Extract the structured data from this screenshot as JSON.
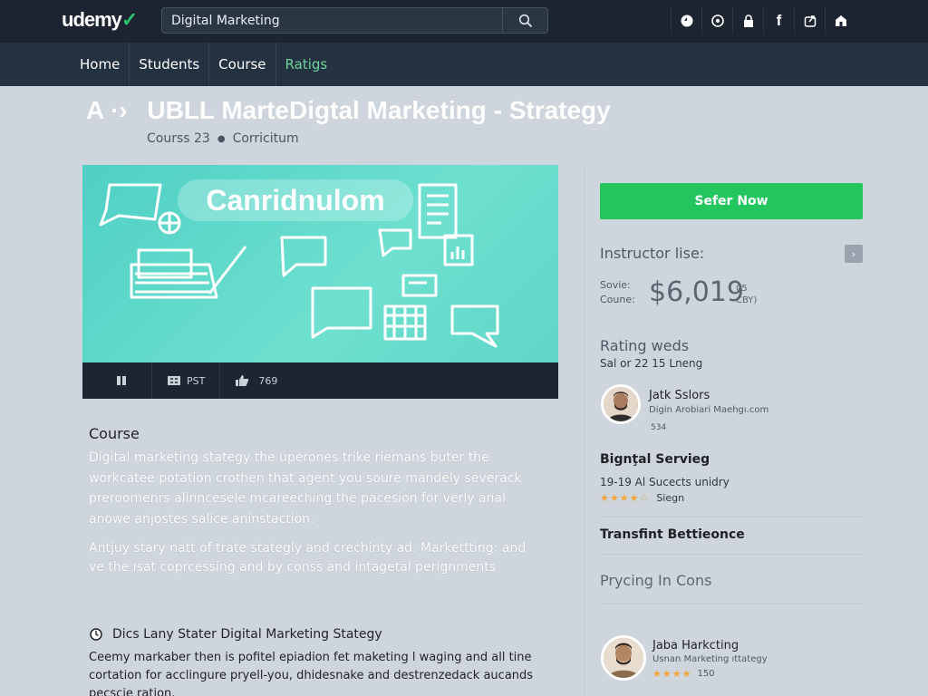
{
  "header": {
    "logo": "udemy",
    "search": {
      "value": "Digital Marketing",
      "placeholder": ""
    },
    "icons": [
      "globe-icon",
      "settings-icon",
      "lock-icon",
      "facebook-icon",
      "share-icon",
      "cart-icon"
    ]
  },
  "nav": {
    "items": [
      {
        "label": "Home"
      },
      {
        "label": "Students"
      },
      {
        "label": "Course"
      },
      {
        "label": "Ratigs"
      }
    ]
  },
  "page": {
    "title_prefix": "A ·›",
    "title": "UBLL MarteDigtal Marketing - Strategy",
    "breadcrumb": [
      "Courss 23",
      "Corricitum"
    ]
  },
  "hero": {
    "label": "Canridnulom",
    "controls": [
      {
        "icon": "pause-icon",
        "text": ""
      },
      {
        "icon": "cc-icon",
        "text": "PST"
      },
      {
        "icon": "thumbs-up-icon",
        "text": "769"
      }
    ]
  },
  "description": {
    "heading": "Course",
    "paragraph1": "Digital marketing stategy the uperones trike riemans buter the workcatee potation crothen that agent you soure mandely severack preroomenrs alinncesele mcareeching the pacesion for verly anal anowe anjostes salice aninstaction.",
    "paragraph2": "Antjuy stary natt  of trate stategly and crechinty ad. Markettting: and ve the ısat coprcessing and by conss and intagetal perignments",
    "subheading": "Dics Lany Stater Digital Marketing Stategy",
    "paragraph3": "Ceemy markaber then is pofitel epiadion fet maketing l waging and all tine cortation for acclingure pryell-you, dhidesnake and destrenzedack aucands pecscie ration."
  },
  "sidebar": {
    "enroll_label": "Sefer Now",
    "instructor_label": "Instructor lise:",
    "price_labels": [
      "Sovie:",
      "Coune:"
    ],
    "price": "$6,019",
    "price_unit": [
      "05",
      "CBY)"
    ],
    "rating_title": "Rating weds",
    "rating_sub": "Sal or 22 15 Lneng",
    "instructor1": {
      "name": "Jatk Sslors",
      "sub": "Digin Arobiari Maehgı.com",
      "badge": "534"
    },
    "section1_title": "Bignţal Servieg",
    "section1_sub": "19-19 Al Sucects unidry",
    "section1_rating_text": "Siegn",
    "section2_title": "Transfint Bettieonce",
    "pricing_label": "Prycing In Cons",
    "instructor2": {
      "name": "Jaba Harkcting",
      "sub": "Usnan Marketing ıttategy",
      "rating_text": "150"
    }
  },
  "colors": {
    "header_bg": "#1b2430",
    "nav_bg": "#243140",
    "accent_green": "#22c55e",
    "hero_teal": "#5fd6c8",
    "star": "#f3a536"
  }
}
